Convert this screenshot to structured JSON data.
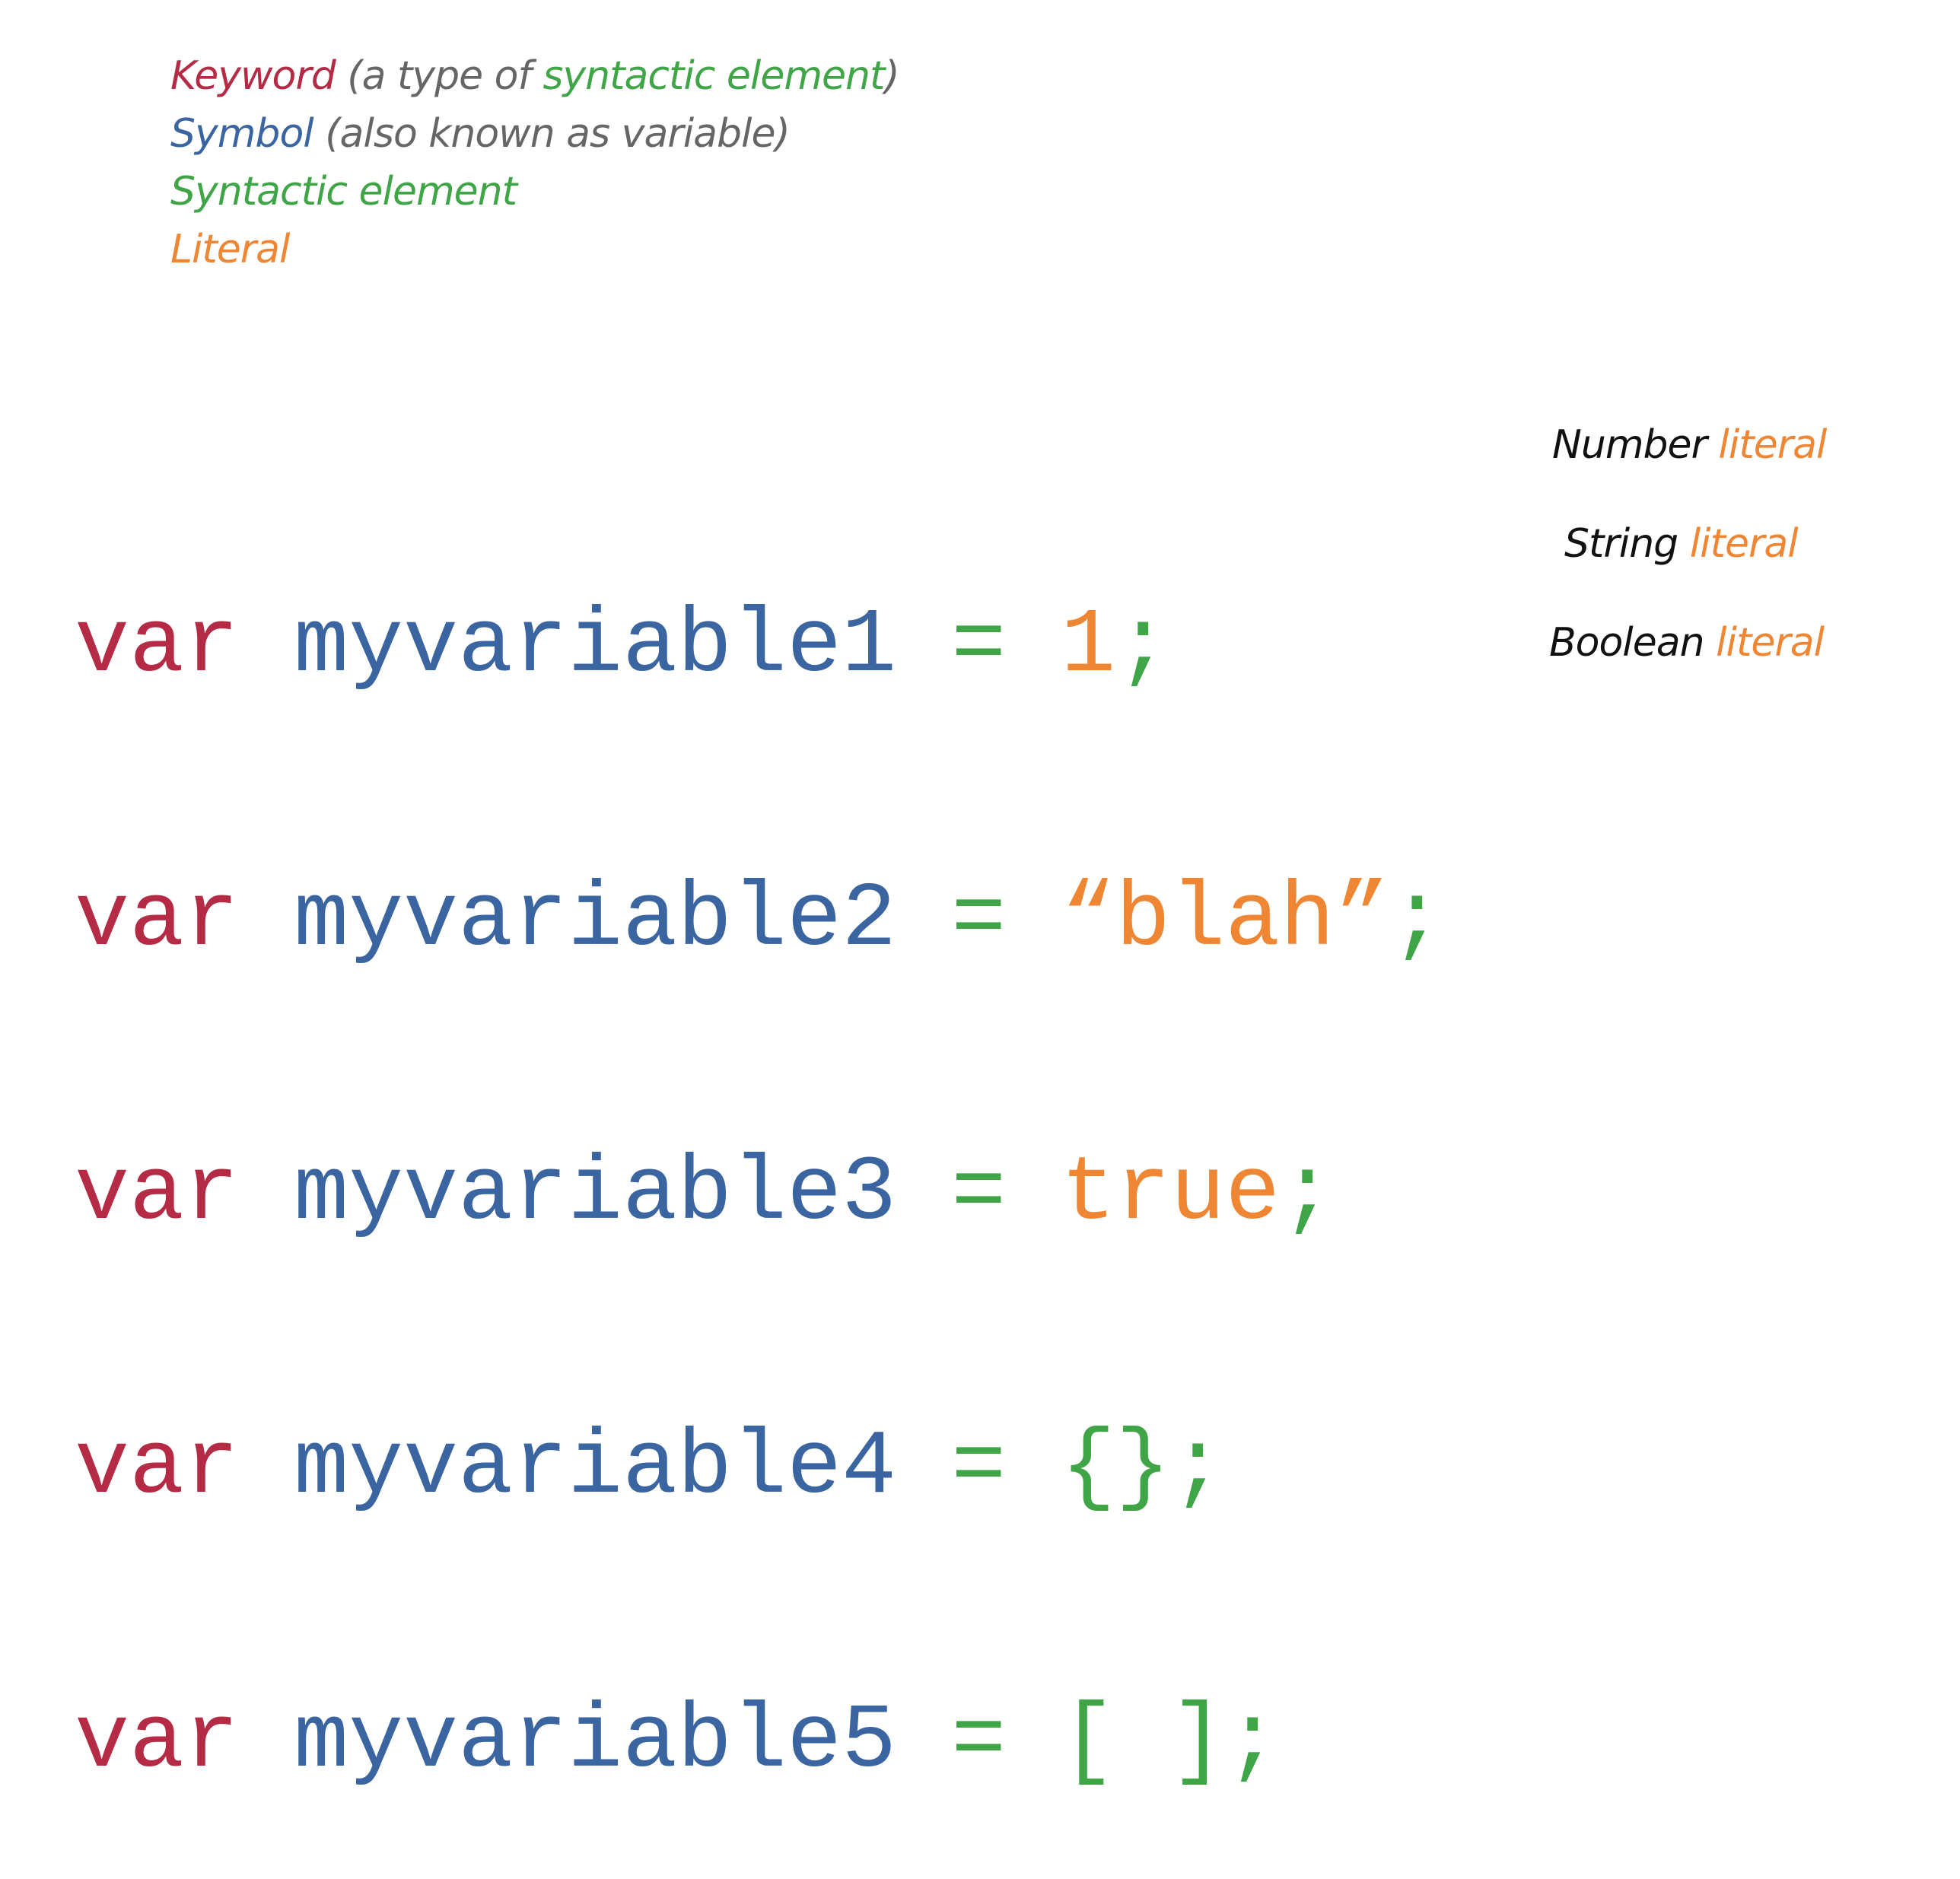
{
  "legend": {
    "keyword_label": "Keyword",
    "keyword_note_open": " (a type of ",
    "keyword_note_syntax": "syntactic element",
    "keyword_note_close": ")",
    "symbol_label": "Symbol",
    "symbol_note": " (also known as variable)",
    "syntax_label": "Syntactic element",
    "literal_label": "Literal"
  },
  "code": {
    "lines": [
      {
        "keyword": "var",
        "symbol": "myvariable1",
        "op": "=",
        "value": "1",
        "value_kind": "literal",
        "term": ";"
      },
      {
        "keyword": "var",
        "symbol": "myvariable2",
        "op": "=",
        "value": "“blah”",
        "value_kind": "literal",
        "term": ";"
      },
      {
        "keyword": "var",
        "symbol": "myvariable3",
        "op": "=",
        "value": "true",
        "value_kind": "literal",
        "term": ";"
      },
      {
        "keyword": "var",
        "symbol": "myvariable4",
        "op": "=",
        "value": "{}",
        "value_kind": "syntax",
        "term": ";"
      },
      {
        "keyword": "var",
        "symbol": "myvariable5",
        "op": "=",
        "value": "[ ]",
        "value_kind": "syntax",
        "term": ";"
      }
    ]
  },
  "annotations": [
    {
      "type": "Number",
      "word": "literal"
    },
    {
      "type": "String",
      "word": "literal"
    },
    {
      "type": "Boolean",
      "word": "literal"
    }
  ],
  "colors": {
    "keyword": "#b52a45",
    "symbol": "#3a65a0",
    "syntax": "#3fa547",
    "literal": "#ef8633",
    "note": "#666666"
  }
}
